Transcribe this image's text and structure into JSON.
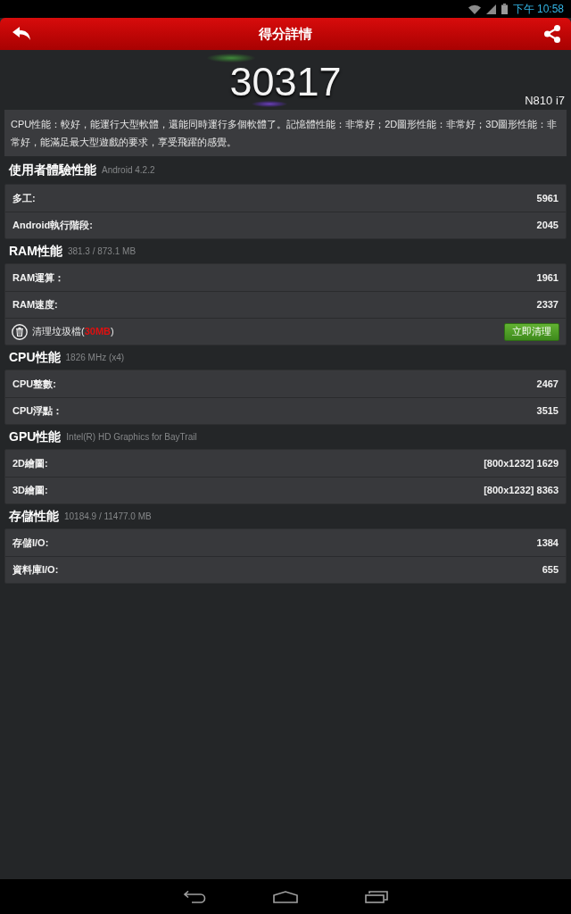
{
  "status_bar": {
    "time": "下午 10:58"
  },
  "header": {
    "title": "得分詳情"
  },
  "score": {
    "value": "30317",
    "device": "N810 i7"
  },
  "summary": "CPU性能：較好，能運行大型軟體，還能同時運行多個軟體了。記憶體性能：非常好；2D圖形性能：非常好；3D圖形性能：非常好，能滿足最大型遊戲的要求，享受飛躍的感覺。",
  "sections": [
    {
      "title": "使用者體驗性能",
      "subtitle": "Android 4.2.2",
      "rows": [
        {
          "kind": "score",
          "label": "多工:",
          "value": "5961"
        },
        {
          "kind": "score",
          "label": "Android執行階段:",
          "value": "2045"
        }
      ]
    },
    {
      "title": "RAM性能",
      "subtitle": "381.3 / 873.1 MB",
      "rows": [
        {
          "kind": "score",
          "label": "RAM運算：",
          "value": "1961"
        },
        {
          "kind": "score",
          "label": "RAM速度:",
          "value": "2337"
        },
        {
          "kind": "cleanup",
          "text_before": "清理垃圾檔(",
          "highlight": "30MB",
          "text_after": ")",
          "button": "立即清理"
        }
      ]
    },
    {
      "title": "CPU性能",
      "subtitle": "1826 MHz (x4)",
      "rows": [
        {
          "kind": "score",
          "label": "CPU整數:",
          "value": "2467"
        },
        {
          "kind": "score",
          "label": "CPU浮點：",
          "value": "3515"
        }
      ]
    },
    {
      "title": "GPU性能",
      "subtitle": "Intel(R) HD Graphics for BayTrail",
      "rows": [
        {
          "kind": "score",
          "label": "2D繪圖:",
          "value": "[800x1232] 1629"
        },
        {
          "kind": "score",
          "label": "3D繪圖:",
          "value": "[800x1232] 8363"
        }
      ]
    },
    {
      "title": "存儲性能",
      "subtitle": "10184.9 / 11477.0 MB",
      "rows": [
        {
          "kind": "score",
          "label": "存儲I/O:",
          "value": "1384"
        },
        {
          "kind": "score",
          "label": "資料庫I/O:",
          "value": "655"
        }
      ]
    }
  ]
}
